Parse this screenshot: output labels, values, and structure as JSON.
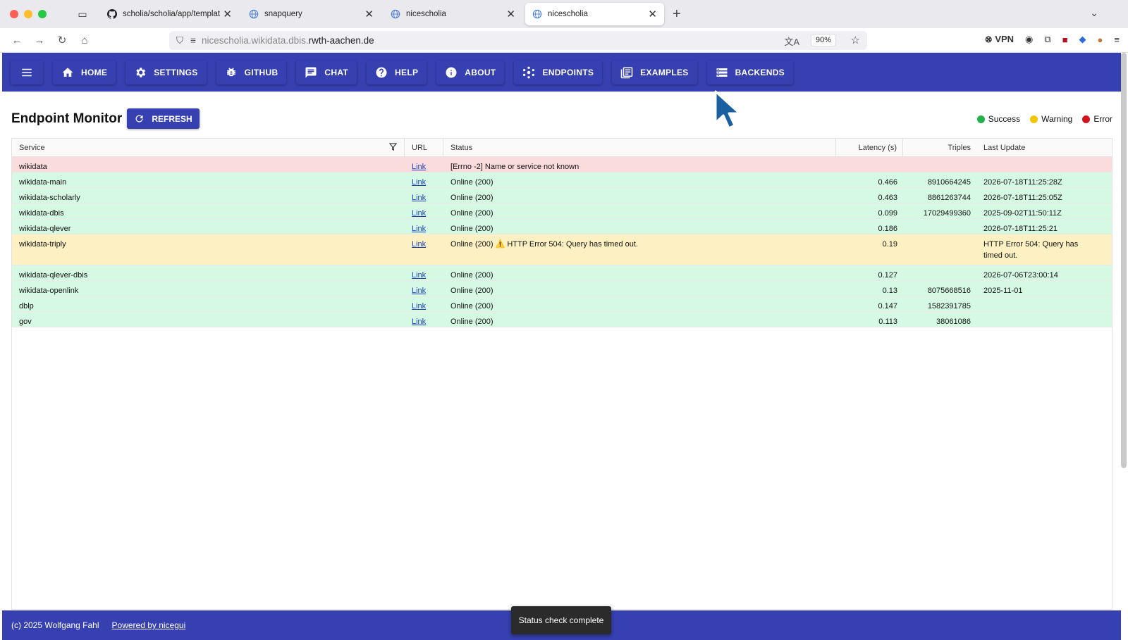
{
  "browser": {
    "tabs": [
      {
        "label": "scholia/scholia/app/templates/a",
        "icon": "github-icon",
        "active": false
      },
      {
        "label": "snapquery",
        "icon": "globe-icon",
        "active": false
      },
      {
        "label": "nicescholia",
        "icon": "globe-icon",
        "active": false
      },
      {
        "label": "nicescholia",
        "icon": "globe-icon",
        "active": true
      }
    ],
    "url_prefix": "nicescholia.wikidata.dbis.",
    "url_host": "rwth-aachen.de",
    "zoom": "90%",
    "vpn_label": "VPN"
  },
  "header": {
    "buttons": [
      {
        "label": "HOME",
        "icon": "home-icon"
      },
      {
        "label": "SETTINGS",
        "icon": "gear-icon"
      },
      {
        "label": "GITHUB",
        "icon": "bug-icon"
      },
      {
        "label": "CHAT",
        "icon": "chat-icon"
      },
      {
        "label": "HELP",
        "icon": "help-icon"
      },
      {
        "label": "ABOUT",
        "icon": "info-icon"
      },
      {
        "label": "ENDPOINTS",
        "icon": "hub-icon"
      },
      {
        "label": "EXAMPLES",
        "icon": "examples-icon"
      },
      {
        "label": "BACKENDS",
        "icon": "storage-icon"
      }
    ]
  },
  "page": {
    "title": "Endpoint Monitor",
    "refresh_label": "REFRESH",
    "legend": [
      {
        "label": "Success",
        "color": "#22b14c"
      },
      {
        "label": "Warning",
        "color": "#f2c500"
      },
      {
        "label": "Error",
        "color": "#d4141c"
      }
    ]
  },
  "table": {
    "columns": [
      "Service",
      "URL",
      "Status",
      "Latency (s)",
      "Triples",
      "Last Update"
    ],
    "rows": [
      {
        "service": "wikidata",
        "url": "Link",
        "status": "[Errno -2] Name or service not known",
        "latency": "",
        "triples": "",
        "updated": "",
        "state": "err"
      },
      {
        "service": "wikidata-main",
        "url": "Link",
        "status": "Online (200)",
        "latency": "0.466",
        "triples": "8910664245",
        "updated": "2026-07-18T11:25:28Z",
        "state": "ok"
      },
      {
        "service": "wikidata-scholarly",
        "url": "Link",
        "status": "Online (200)",
        "latency": "0.463",
        "triples": "8861263744",
        "updated": "2026-07-18T11:25:05Z",
        "state": "ok"
      },
      {
        "service": "wikidata-dbis",
        "url": "Link",
        "status": "Online (200)",
        "latency": "0.099",
        "triples": "17029499360",
        "updated": "2025-09-02T11:50:11Z",
        "state": "ok"
      },
      {
        "service": "wikidata-qlever",
        "url": "Link",
        "status": "Online (200)",
        "latency": "0.186",
        "triples": "",
        "updated": "2026-07-18T11:25:21",
        "state": "ok"
      },
      {
        "service": "wikidata-triply",
        "url": "Link",
        "status": "Online (200) ⚠️ HTTP Error 504: Query has timed out.",
        "latency": "0.19",
        "triples": "",
        "updated": "HTTP Error 504: Query has timed out.",
        "state": "warn"
      },
      {
        "service": "wikidata-qlever-dbis",
        "url": "Link",
        "status": "Online (200)",
        "latency": "0.127",
        "triples": "",
        "updated": "2026-07-06T23:00:14",
        "state": "ok"
      },
      {
        "service": "wikidata-openlink",
        "url": "Link",
        "status": "Online (200)",
        "latency": "0.13",
        "triples": "8075668516",
        "updated": "2025-11-01",
        "state": "ok"
      },
      {
        "service": "dblp",
        "url": "Link",
        "status": "Online (200)",
        "latency": "0.147",
        "triples": "1582391785",
        "updated": "",
        "state": "ok"
      },
      {
        "service": "gov",
        "url": "Link",
        "status": "Online (200)",
        "latency": "0.113",
        "triples": "38061086",
        "updated": "",
        "state": "ok"
      }
    ]
  },
  "footer": {
    "copyright": "(c) 2025 Wolfgang Fahl",
    "powered": "Powered by nicegui"
  },
  "toast": "Status check complete"
}
